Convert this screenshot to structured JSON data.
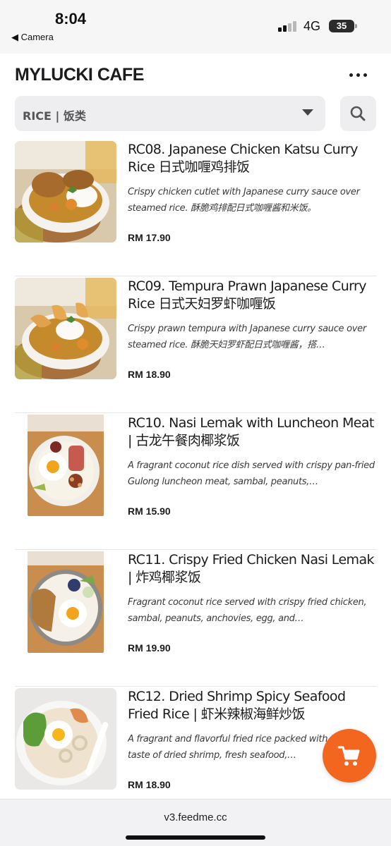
{
  "status_bar": {
    "time": "8:04",
    "back_label": "◀ Camera",
    "network": "4G",
    "battery": "35"
  },
  "header": {
    "title": "MYLUCKI CAFE",
    "category": "RICE | 饭类"
  },
  "menu_items": [
    {
      "name": "RC08. Japanese Chicken Katsu Curry Rice 日式咖喱鸡排饭",
      "description": "Crispy chicken cutlet with Japanese curry sauce over steamed rice. 酥脆鸡排配日式咖喱酱和米饭。",
      "price": "RM 17.90"
    },
    {
      "name": "RC09. Tempura Prawn Japanese Curry Rice 日式天妇罗虾咖喱饭",
      "description": "Crispy prawn tempura with Japanese curry sauce over steamed rice. 酥脆天妇罗虾配日式咖喱酱，搭…",
      "price": "RM 18.90"
    },
    {
      "name": "RC10. Nasi Lemak with Luncheon Meat | 古龙午餐肉椰浆饭",
      "description": "A fragrant coconut rice dish served with crispy pan-fried Gulong luncheon meat, sambal, peanuts,…",
      "price": "RM 15.90"
    },
    {
      "name": "RC11. Crispy Fried Chicken Nasi Lemak | 炸鸡椰浆饭",
      "description": "Fragrant coconut rice served with crispy fried chicken, sambal, peanuts, anchovies, egg, and…",
      "price": "RM 19.90"
    },
    {
      "name": "RC12. Dried Shrimp Spicy Seafood Fried Rice | 虾米辣椒海鲜炒饭",
      "description": "A fragrant and flavorful fried rice packed with the bold taste of dried shrimp, fresh seafood,…",
      "price": "RM 18.90"
    }
  ],
  "footer": {
    "url": "v3.feedme.cc"
  },
  "icons": {
    "more": "more-dots-icon",
    "dropdown": "chevron-down-icon",
    "search": "search-icon",
    "cart": "cart-icon"
  },
  "colors": {
    "accent": "#f3661f",
    "field_background": "#eeeef1"
  }
}
